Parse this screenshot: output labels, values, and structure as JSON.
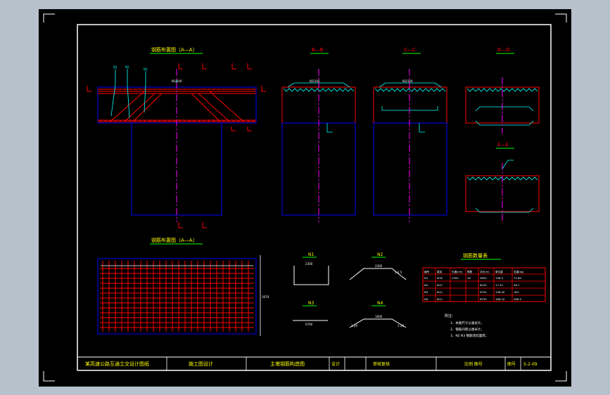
{
  "colors": {
    "background": "#000000",
    "frame": "#ffffff",
    "title_text": "#ffff00",
    "section_title": "#00ff00",
    "rebar": "#ff0000",
    "outline": "#0000ff",
    "leader": "#00ffff",
    "centerline": "#ff00ff"
  },
  "views": {
    "elevation_title": "钢筋布置图（A—A）",
    "plan_title": "钢筋布置图（A—A）",
    "section_b": "B—B",
    "section_c": "C—C",
    "section_d": "D—D",
    "section_e": "E—E",
    "top_dim": "N1/200",
    "b_dim": "N3/100",
    "c_dim": "N3/100",
    "plan_right_dim": "1670"
  },
  "details": {
    "n1_label": "N1",
    "n1_dim": "2300",
    "n2_label": "N2",
    "n2_dim": "2300",
    "n2_slope": "1:2.5",
    "n3_label": "N3",
    "n3_dim": "6700",
    "n4_label": "N4",
    "n4_dim": "1600",
    "n4_left": "1:20",
    "n4_right": "1:20"
  },
  "table": {
    "title": "钢筋数量表",
    "headers": [
      "编号",
      "直径",
      "长度(cm)",
      "根数",
      "共长(m)",
      "单位重",
      "总重(kg)"
    ],
    "rows": [
      [
        "N1",
        "Φ16",
        "2300",
        "18",
        "3600",
        "198.5",
        "72.80"
      ],
      [
        "N2",
        "Φ12",
        "",
        "",
        "8200",
        "17.32",
        "46.7"
      ],
      [
        "N3",
        "Φ12",
        "",
        "",
        "6700",
        "198.00",
        "183"
      ],
      [
        "N4",
        "Φ12",
        "",
        "",
        "6750",
        "188.10",
        "286.5"
      ]
    ]
  },
  "notes": {
    "title": "附注:",
    "lines": [
      "1、本图尺寸以毫米计。",
      "2、钢筋间距以厘米计。",
      "3、N2 N3 钢筋须双面焊。"
    ]
  },
  "title_block": {
    "project": "某高速公路互通立交设计图纸",
    "stage": "施工图设计",
    "drawing": "主墩钢筋构造图",
    "design_label": "设计",
    "designer": "审核复核",
    "scale_label": "比例 图号",
    "sheet_label": "图号",
    "sheet_no": "S-2-09"
  }
}
